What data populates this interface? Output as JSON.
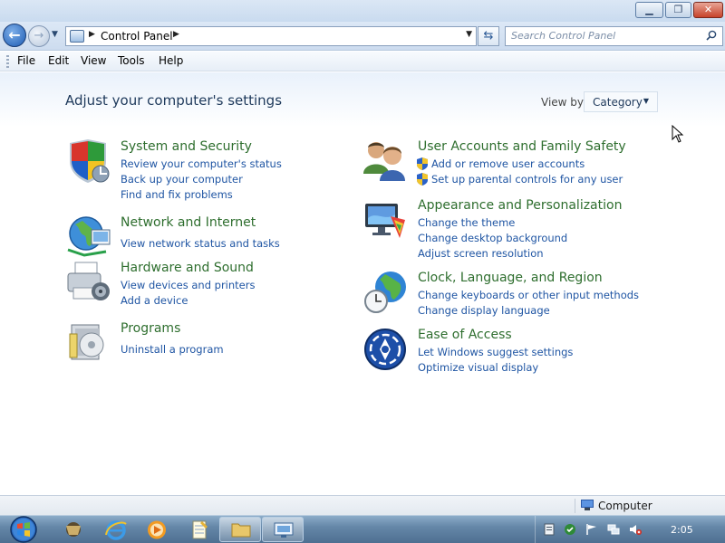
{
  "window": {
    "minimize_icon": "minimize-icon",
    "maximize_icon": "restore-icon",
    "close_icon": "close-icon"
  },
  "navigation": {
    "back_icon": "arrow-left-icon",
    "forward_icon": "arrow-right-icon",
    "breadcrumb": "Control Panel",
    "search_placeholder": "Search Control Panel"
  },
  "menu": {
    "items": [
      "File",
      "Edit",
      "View",
      "Tools",
      "Help"
    ]
  },
  "main": {
    "title": "Adjust your computer's settings",
    "view_by_label": "View by:",
    "view_by_value": "Category",
    "categories": [
      {
        "title": "System and Security",
        "icon": "shield-icon",
        "links": [
          "Review your computer's status",
          "Back up your computer",
          "Find and fix problems"
        ]
      },
      {
        "title": "Network and Internet",
        "icon": "globe-network-icon",
        "links": [
          "View network status and tasks"
        ]
      },
      {
        "title": "Hardware and Sound",
        "icon": "printer-icon",
        "links": [
          "View devices and printers",
          "Add a device"
        ]
      },
      {
        "title": "Programs",
        "icon": "programs-icon",
        "links": [
          "Uninstall a program"
        ]
      },
      {
        "title": "User Accounts and Family Safety",
        "icon": "users-icon",
        "links": [
          "Add or remove user accounts",
          "Set up parental controls for any user"
        ]
      },
      {
        "title": "Appearance and Personalization",
        "icon": "display-icon",
        "links": [
          "Change the theme",
          "Change desktop background",
          "Adjust screen resolution"
        ]
      },
      {
        "title": "Clock, Language, and Region",
        "icon": "clock-globe-icon",
        "links": [
          "Change keyboards or other input methods",
          "Change display language"
        ]
      },
      {
        "title": "Ease of Access",
        "icon": "ease-of-access-icon",
        "links": [
          "Let Windows suggest settings",
          "Optimize visual display"
        ]
      }
    ]
  },
  "statusbar": {
    "text": "Computer"
  },
  "taskbar": {
    "clock": "2:05"
  }
}
